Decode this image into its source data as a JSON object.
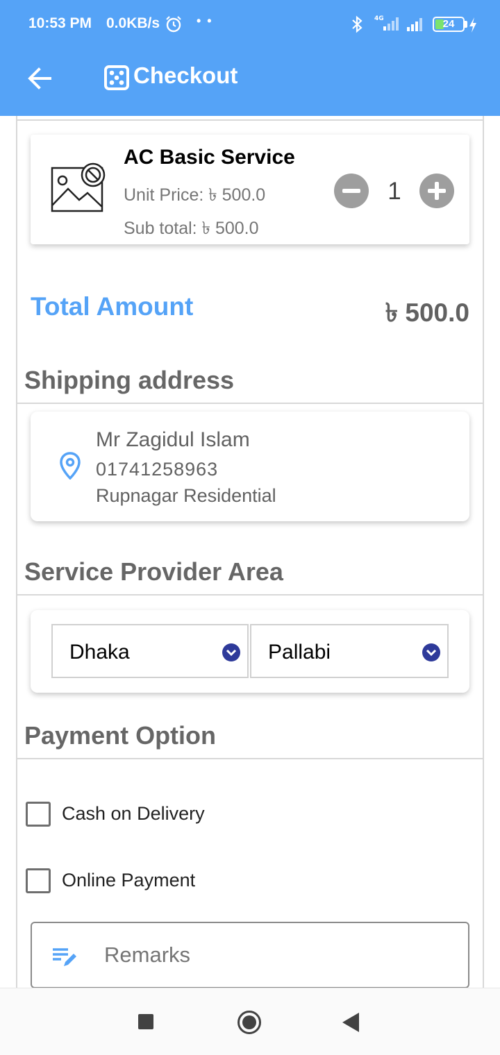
{
  "status_bar": {
    "time": "10:53 PM",
    "network_speed": "0.0KB/s",
    "dots": "• •",
    "battery_level": "24",
    "icons": [
      "alarm-icon",
      "bluetooth-icon",
      "signal-4g-icon",
      "signal-icon",
      "battery-icon",
      "charging-icon"
    ]
  },
  "toolbar": {
    "title": "Checkout",
    "back_icon": "arrow-left-icon",
    "title_icon": "dice-icon"
  },
  "cart": {
    "item": {
      "name": "AC Basic Service",
      "unit_price": "Unit Price: ৳ 500.0",
      "sub_total": "Sub total: ৳ 500.0",
      "quantity": "1",
      "image_icon": "broken-image-icon"
    }
  },
  "total": {
    "label": "Total Amount",
    "value": "৳ 500.0"
  },
  "shipping": {
    "title": "Shipping address",
    "name": "Mr Zagidul Islam",
    "phone": "01741258963",
    "address": "Rupnagar Residential",
    "icon": "location-pin-icon"
  },
  "area": {
    "title": "Service Provider Area",
    "city": "Dhaka",
    "zone": "Pallabi"
  },
  "payment": {
    "title": "Payment Option",
    "options": [
      "Cash on Delivery",
      "Online Payment"
    ],
    "cash_checked": false,
    "online_checked": false
  },
  "remarks": {
    "placeholder": "Remarks",
    "icon": "edit-notes-icon"
  },
  "nav": {
    "icons": [
      "recents-square-icon",
      "home-circle-icon",
      "back-triangle-icon"
    ]
  },
  "colors": {
    "primary": "#55a3f7",
    "text_gray": "#666666",
    "select_icon": "#2e3a9a",
    "battery_green": "#7be36f"
  }
}
